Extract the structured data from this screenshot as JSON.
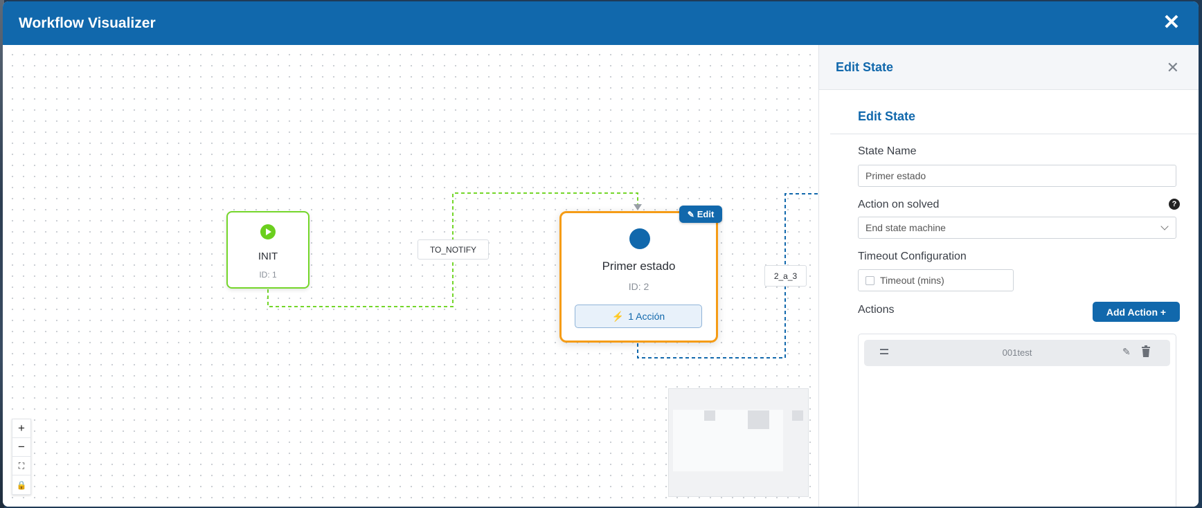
{
  "modal": {
    "title": "Workflow Visualizer",
    "close_symbol": "✕"
  },
  "canvas": {
    "nodes": {
      "init": {
        "title": "INIT",
        "id_text": "ID: 1",
        "icon": "play-icon"
      },
      "state": {
        "title": "Primer estado",
        "id_text": "ID: 2",
        "action_badge": "1 Acción",
        "edit_label": "Edit",
        "icon": "state-dot-icon"
      }
    },
    "edges": [
      {
        "label": "TO_NOTIFY",
        "color": "#74d62a"
      },
      {
        "label": "2_a_3",
        "color": "#1168ac"
      }
    ],
    "controls": {
      "zoom_in": "+",
      "zoom_out": "−",
      "fit": "⛶",
      "lock": "🔒"
    }
  },
  "panel": {
    "title": "Edit State",
    "close_symbol": "✕",
    "form_heading": "Edit State",
    "state_name_label": "State Name",
    "state_name_value": "Primer estado",
    "action_on_solved_label": "Action on solved",
    "action_on_solved_value": "End state machine",
    "help_symbol": "?",
    "timeout_config_label": "Timeout Configuration",
    "timeout_checkbox_label": "Timeout (mins)",
    "actions_label": "Actions",
    "add_action_label": "Add Action +",
    "actions": [
      {
        "name": "001test"
      }
    ]
  },
  "colors": {
    "header": "#1168ac",
    "init_border": "#74d62a",
    "state_border": "#f59c16",
    "accent": "#1168ac"
  }
}
